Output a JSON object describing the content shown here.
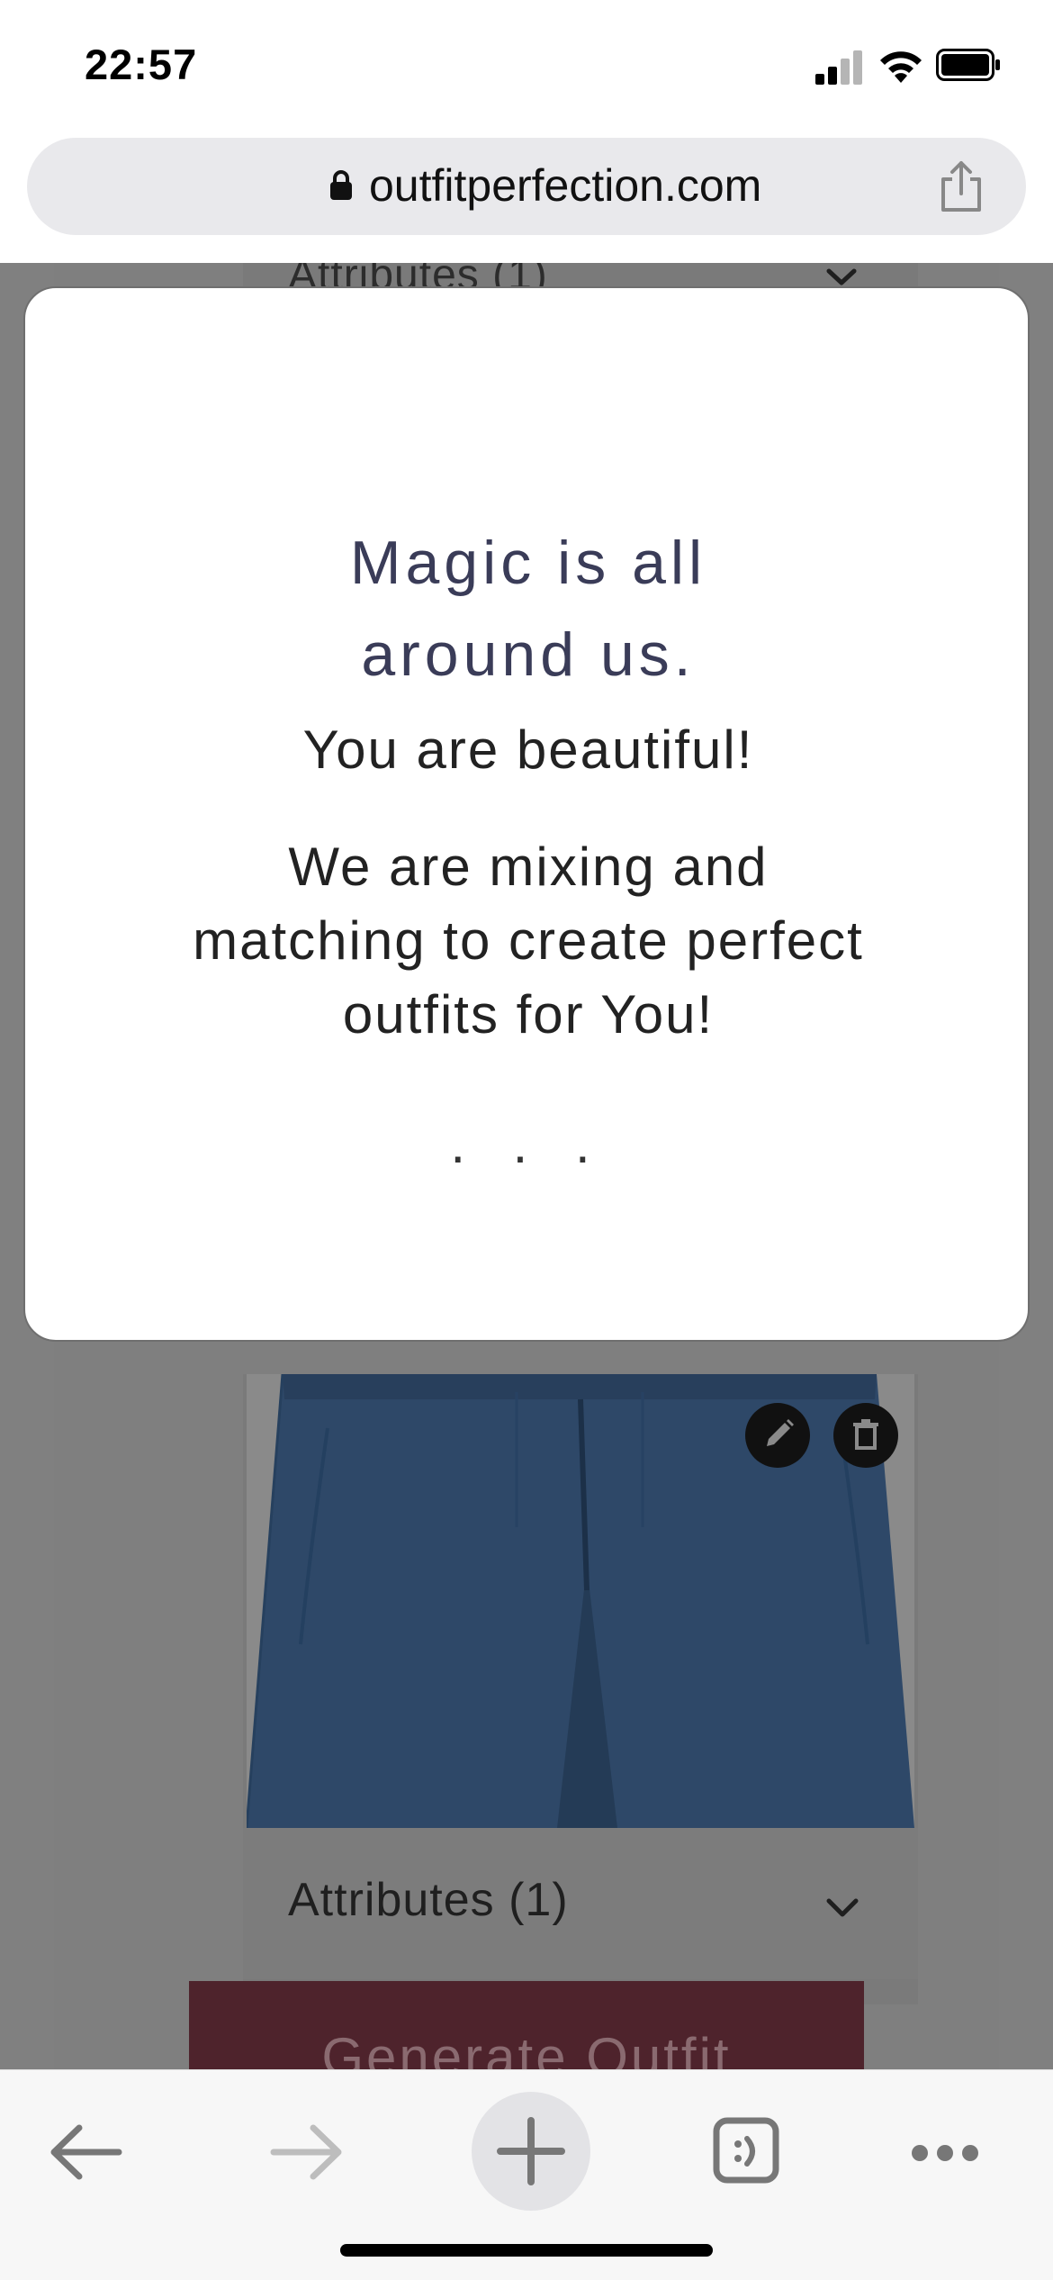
{
  "status_bar": {
    "time": "22:57",
    "icons": [
      "cellular-signal-icon",
      "wifi-icon",
      "battery-icon"
    ]
  },
  "browser": {
    "url": "outfitperfection.com",
    "lock_icon": "lock-icon",
    "share_icon": "share-icon"
  },
  "background_page": {
    "top_card_attributes_label": "Attributes (1)",
    "item_card": {
      "image": "navy blue shorts",
      "edit_icon": "pencil-icon",
      "delete_icon": "trash-icon",
      "attributes_label": "Attributes (1)"
    },
    "generate_button_label": "Generate Outfit"
  },
  "modal": {
    "title": "Magic is all around us.",
    "line1": "You are beautiful!",
    "line2": "We are mixing and matching to create perfect outfits for You!",
    "dots": ". . ."
  },
  "toolbar": {
    "icons": [
      "back-arrow-icon",
      "forward-arrow-icon",
      "plus-icon",
      "tabs-icon",
      "more-icon"
    ]
  },
  "colors": {
    "overlay": "#808080",
    "modal_title": "#3a3c58",
    "generate_button": "#4e232c",
    "shorts": "#2e4868"
  }
}
